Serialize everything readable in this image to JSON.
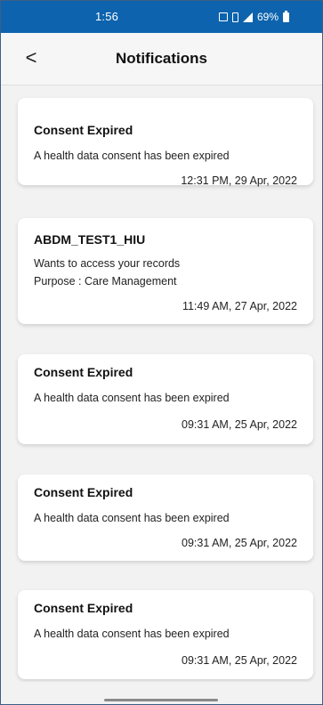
{
  "status_bar": {
    "time": "1:56",
    "battery": "69%",
    "icons": [
      "sim-icon",
      "vibrate-icon",
      "signal-icon",
      "battery-icon"
    ]
  },
  "header": {
    "back_icon": "chevron-left-icon",
    "back_glyph": "<",
    "title": "Notifications"
  },
  "notifications": [
    {
      "title": "Consent Expired",
      "lines": [
        "A health data consent has been expired"
      ],
      "time": "12:31 PM, 29 Apr, 2022"
    },
    {
      "title": "ABDM_TEST1_HIU",
      "lines": [
        "Wants to access your records",
        "Purpose : Care Management"
      ],
      "time": "11:49 AM, 27 Apr, 2022"
    },
    {
      "title": "Consent Expired",
      "lines": [
        "A health data consent has been expired"
      ],
      "time": "09:31 AM, 25 Apr, 2022"
    },
    {
      "title": "Consent Expired",
      "lines": [
        "A health data consent has been expired"
      ],
      "time": "09:31 AM, 25 Apr, 2022"
    },
    {
      "title": "Consent Expired",
      "lines": [
        "A health data consent has been expired"
      ],
      "time": "09:31 AM, 25 Apr, 2022"
    }
  ],
  "colors": {
    "status_bar": "#0d63ad",
    "page_background": "#f2f2f2",
    "card_background": "#ffffff"
  }
}
